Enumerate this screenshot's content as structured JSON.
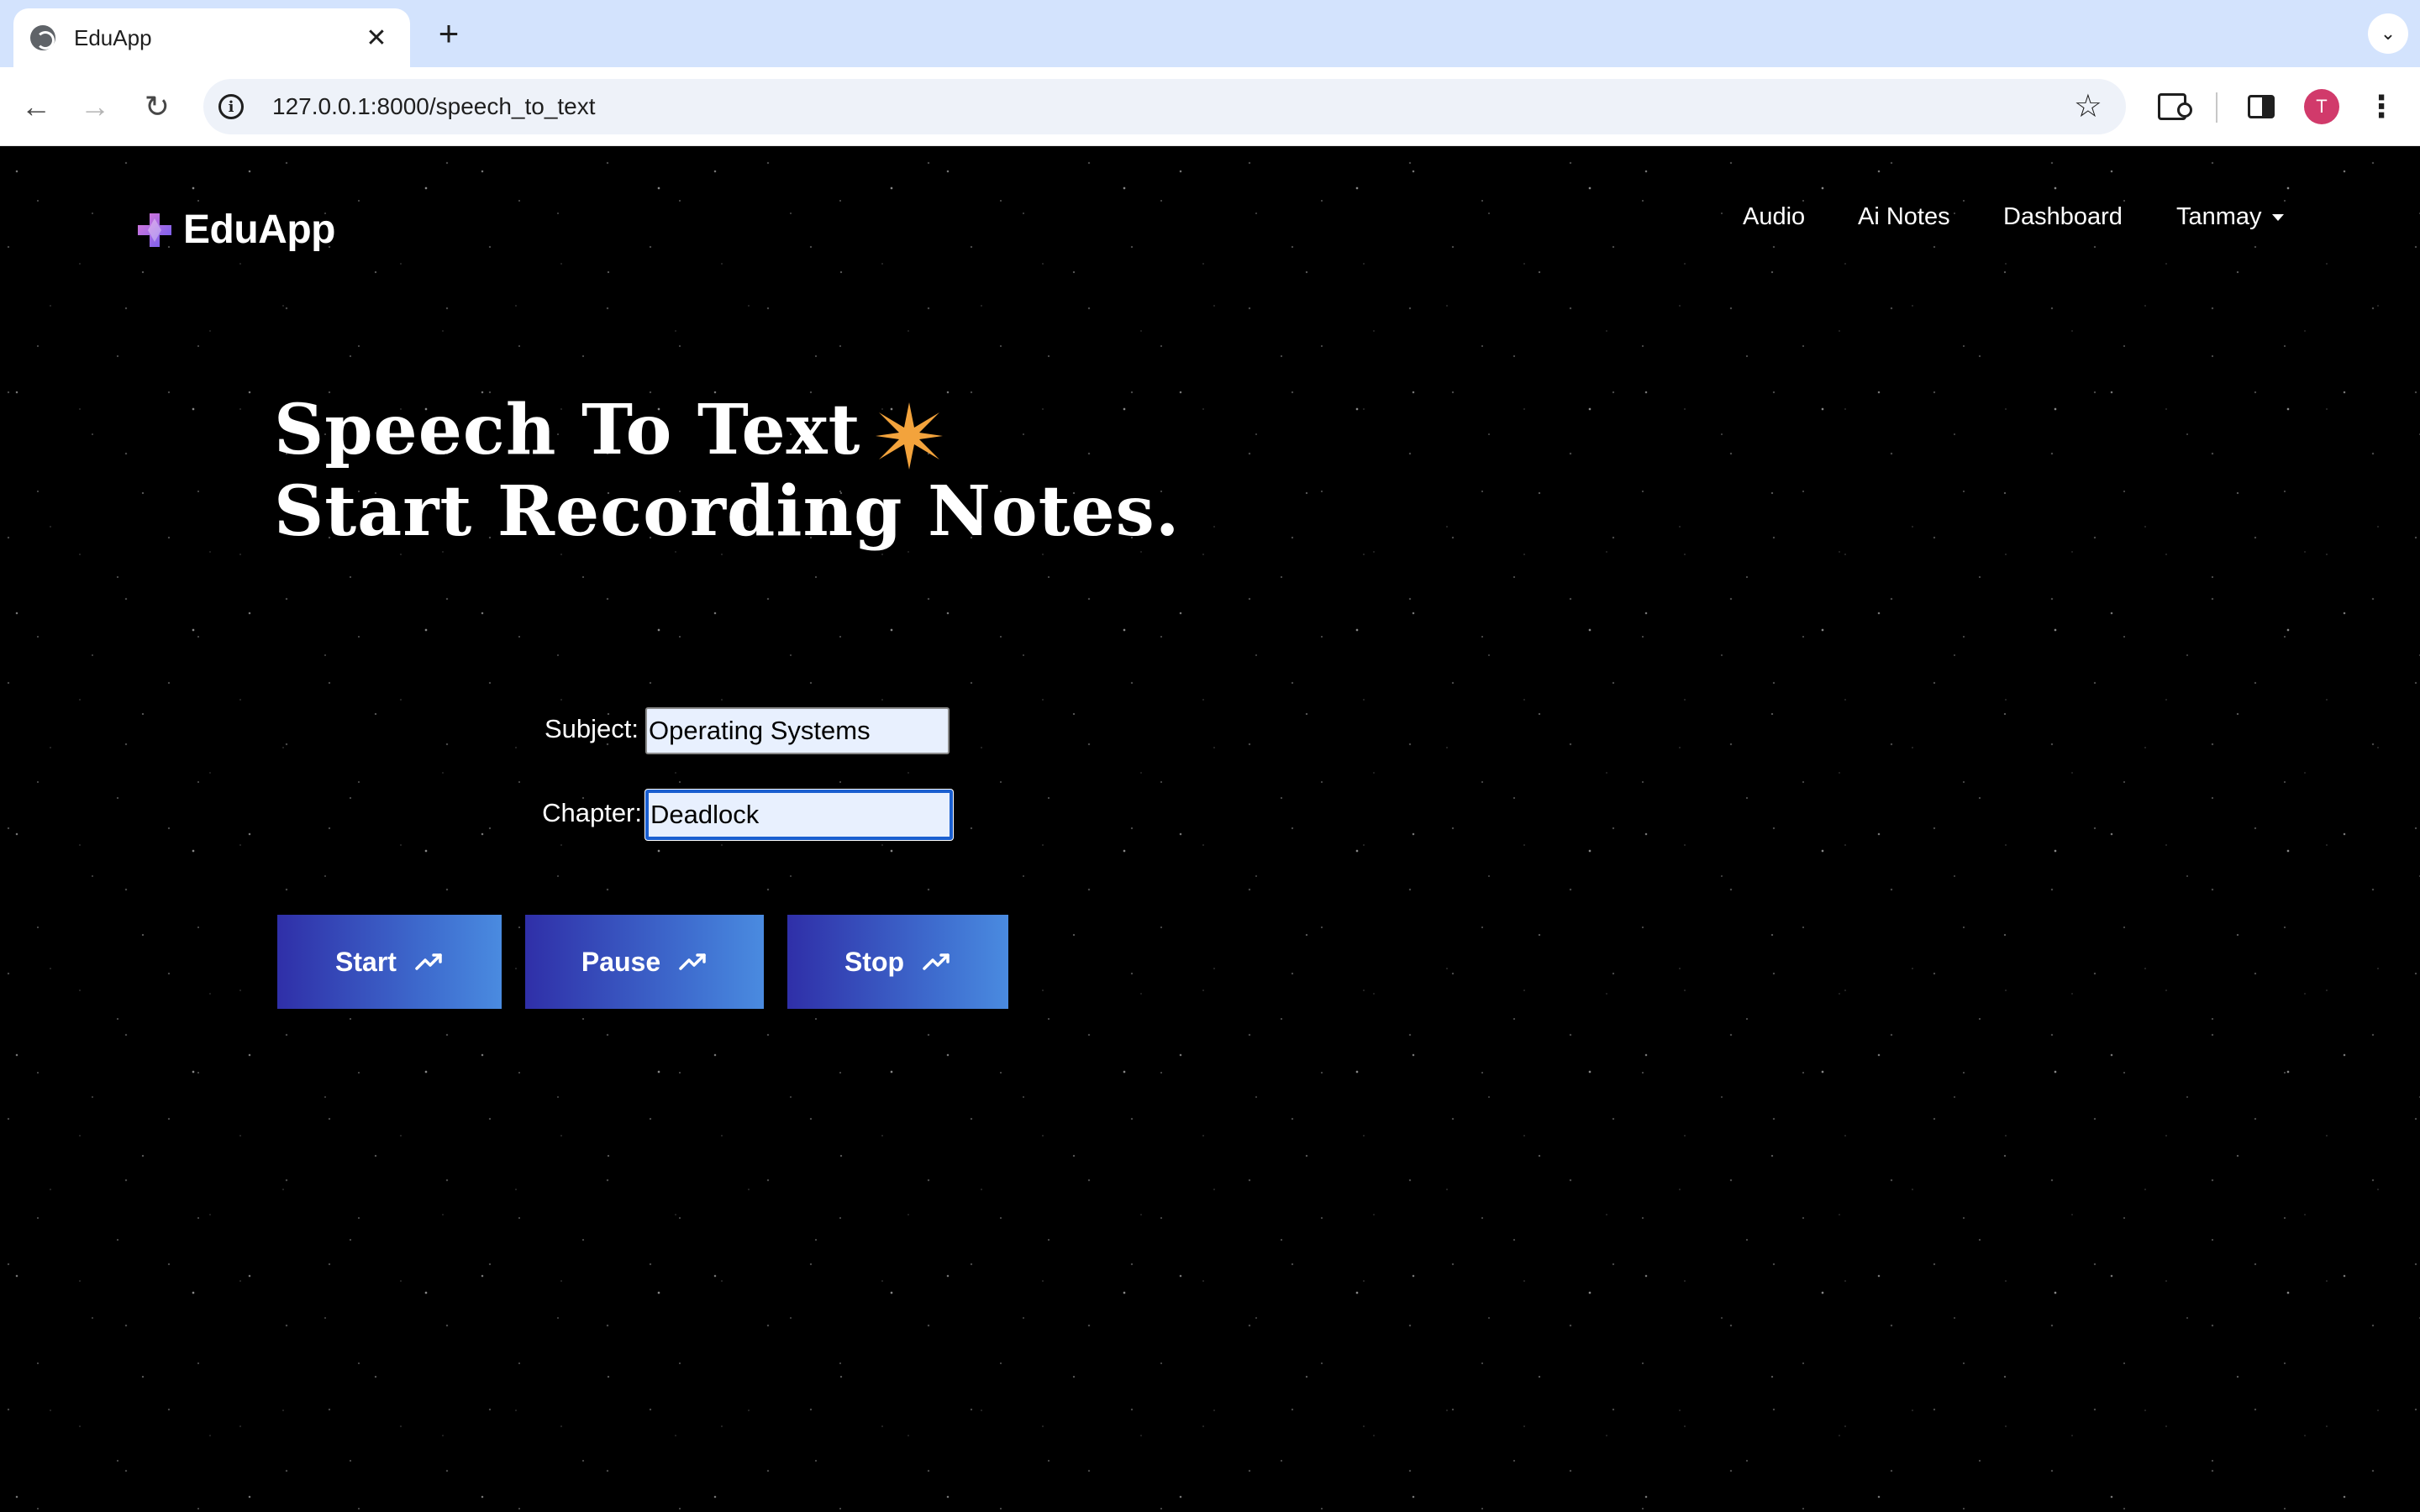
{
  "browser": {
    "tab_title": "EduApp",
    "tab_close": "✕",
    "new_tab": "+",
    "tab_search": "⌄",
    "url": "127.0.0.1:8000/speech_to_text",
    "back": "←",
    "forward": "→",
    "reload": "↻",
    "star": "☆",
    "avatar_initial": "T",
    "menu": "⋮"
  },
  "app": {
    "brand": "EduApp",
    "brand_icon": "plus-gem-icon",
    "nav": {
      "audio": "Audio",
      "ai_notes": "Ai Notes",
      "dashboard": "Dashboard",
      "user": "Tanmay"
    }
  },
  "hero": {
    "line1": "Speech To Text",
    "line2": "Start Recording Notes.",
    "sparkle_color": "#f3a33c"
  },
  "form": {
    "subject_label": "Subject:",
    "subject_value": "Operating Systems",
    "chapter_label": "Chapter:",
    "chapter_value": "Deadlock"
  },
  "actions": {
    "start": "Start",
    "pause": "Pause",
    "stop": "Stop",
    "icon": "trending-up-icon"
  },
  "colors": {
    "button_gradient_start": "#2f2fa8",
    "button_gradient_end": "#4a8be0",
    "input_bg": "#e8f0fe",
    "focus_ring": "#1a5fd0"
  }
}
